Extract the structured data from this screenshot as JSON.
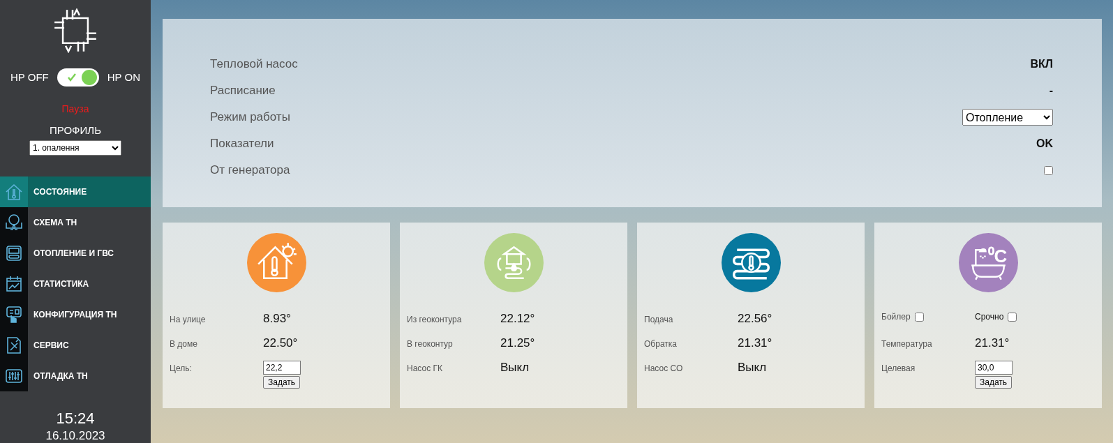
{
  "sidebar": {
    "toggle": {
      "off_label": "HP OFF",
      "on_label": "HP ON",
      "on": true
    },
    "status": "Пауза",
    "profile_label": "ПРОФИЛЬ",
    "profile_value": "1. опалення",
    "nav": [
      {
        "label": "СОСТОЯНИЕ",
        "selected": true
      },
      {
        "label": "СХЕМА ТН",
        "selected": false
      },
      {
        "label": "ОТОПЛЕНИЕ И ГВС",
        "selected": false
      },
      {
        "label": "СТАТИСТИКА",
        "selected": false
      },
      {
        "label": "КОНФИГУРАЦИЯ ТН",
        "selected": false
      },
      {
        "label": "СЕРВИС",
        "selected": false
      },
      {
        "label": "ОТЛАДКА ТН",
        "selected": false
      }
    ],
    "time": "15:24",
    "date": "16.10.2023"
  },
  "status_panel": [
    {
      "label": "Тепловой насос",
      "kind": "text",
      "value": "ВКЛ"
    },
    {
      "label": "Расписание",
      "kind": "text",
      "value": "-"
    },
    {
      "label": "Режим работы",
      "kind": "select",
      "value": "Отопление"
    },
    {
      "label": "Показатели",
      "kind": "text",
      "value": "OK"
    },
    {
      "label": "От генератора",
      "kind": "checkbox",
      "checked": false
    }
  ],
  "cards": [
    {
      "color": "#f79239",
      "rows": [
        {
          "kind": "value",
          "label": "На улице",
          "value": "8.93°"
        },
        {
          "kind": "value",
          "label": "В доме",
          "value": "22.50°"
        },
        {
          "kind": "input",
          "label": "Цель:",
          "value": "22,2",
          "button": "Задать"
        }
      ]
    },
    {
      "color": "#b5d48a",
      "rows": [
        {
          "kind": "value",
          "label": "Из геоконтура",
          "value": "22.12°"
        },
        {
          "kind": "value",
          "label": "В геоконтур",
          "value": "21.25°"
        },
        {
          "kind": "value",
          "label": "Насос ГК",
          "value": "Выкл"
        }
      ]
    },
    {
      "color": "#07789e",
      "rows": [
        {
          "kind": "value",
          "label": "Подача",
          "value": "22.56°"
        },
        {
          "kind": "value",
          "label": "Обратка",
          "value": "21.31°"
        },
        {
          "kind": "value",
          "label": "Насос СО",
          "value": "Выкл"
        }
      ]
    },
    {
      "color": "#a382bd",
      "icon_text": "⁰C",
      "rows": [
        {
          "kind": "checks",
          "items": [
            {
              "label": "Бойлер",
              "checked": false
            },
            {
              "label": "Срочно",
              "checked": false
            }
          ]
        },
        {
          "kind": "value",
          "label": "Температура",
          "value": "21.31°"
        },
        {
          "kind": "input",
          "label": "Целевая",
          "value": "30,0",
          "button": "Задать"
        }
      ]
    }
  ]
}
